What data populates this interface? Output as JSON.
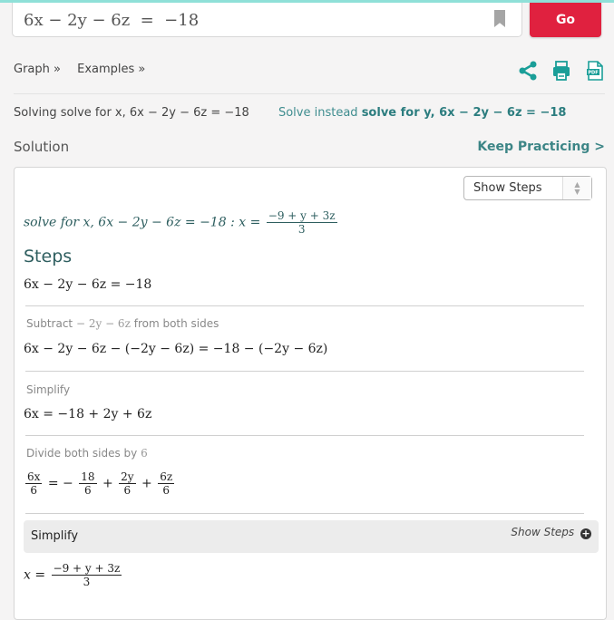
{
  "search": {
    "value": "6x − 2y − 6z  =  −18",
    "go_label": "Go"
  },
  "nav": {
    "graph": "Graph »",
    "examples": "Examples »"
  },
  "tools": {
    "share": "share-icon",
    "print": "print-icon",
    "pdf": "pdf-icon"
  },
  "solving": {
    "text": "Solving solve for x, 6x − 2y − 6z = −18",
    "instead_prefix": "Solve instead",
    "instead_link": "solve for y, 6x − 2y − 6z = −18"
  },
  "solution": {
    "title": "Solution",
    "keep_practicing": "Keep Practicing >",
    "steps_select": "Show Steps",
    "result_prefix": "solve for x, 6x − 2y − 6z = −18   :   ",
    "result_lhs": "x =",
    "result_num": "−9 + y + 3z",
    "result_den": "3"
  },
  "steps": {
    "heading": "Steps",
    "initial": "6x − 2y − 6z =  −18",
    "items": [
      {
        "desc_prefix": "Subtract",
        "desc_math": "− 2y − 6z",
        "desc_suffix": "from both sides",
        "eq": "6x − 2y − 6z − (−2y − 6z) =  −18 − (−2y − 6z)"
      },
      {
        "desc_prefix": "Simplify",
        "eq": "6x =  −18 + 2y + 6z"
      },
      {
        "desc_prefix": "Divide both sides by",
        "desc_math": "6",
        "fracs": [
          {
            "num": "6x",
            "den": "6"
          },
          {
            "num": "18",
            "den": "6"
          },
          {
            "num": "2y",
            "den": "6"
          },
          {
            "num": "6z",
            "den": "6"
          }
        ]
      }
    ],
    "simplify_bar": {
      "label": "Simplify",
      "show_steps": "Show Steps"
    },
    "final_lhs": "x =",
    "final_num": "−9 + y + 3z",
    "final_den": "3"
  },
  "colors": {
    "accent": "#e0213f",
    "teal": "#2c7d7f",
    "top_strip": "#8fe0d8"
  }
}
